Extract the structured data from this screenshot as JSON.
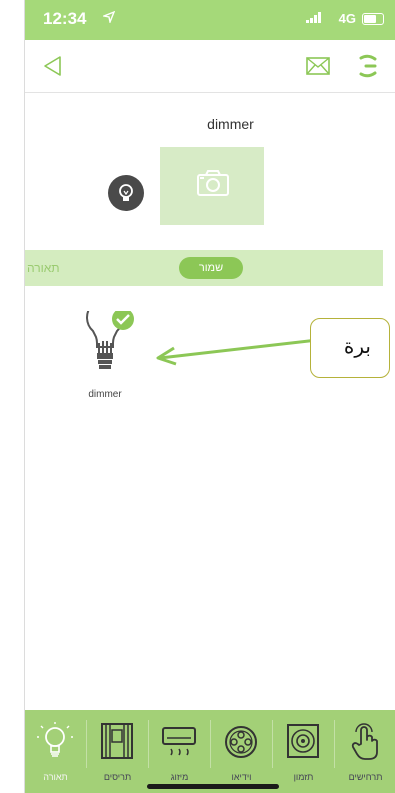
{
  "status_bar": {
    "time": "12:34",
    "network": "4G"
  },
  "nav": {
    "icons": [
      "back-icon",
      "mail-icon",
      "refresh-icon"
    ]
  },
  "device": {
    "name": "dimmer",
    "badge_icon": "lightbulb-icon",
    "photo_icon": "camera-icon"
  },
  "filter": {
    "category": "תאורה",
    "save_label": "שמור"
  },
  "devices": [
    {
      "label": "dimmer",
      "icon": "lightbulb-icon",
      "selected": true
    }
  ],
  "callout": {
    "text": "برة"
  },
  "bottom_nav": {
    "tabs": [
      {
        "label": "תאורה",
        "icon": "lightbulb-icon",
        "active": true
      },
      {
        "label": "תריסים",
        "icon": "window-blinds-icon",
        "active": false
      },
      {
        "label": "מיזוג",
        "icon": "air-conditioner-icon",
        "active": false
      },
      {
        "label": "וידיאו",
        "icon": "film-reel-icon",
        "active": false
      },
      {
        "label": "תזמון",
        "icon": "timer-icon",
        "active": false
      },
      {
        "label": "תרחישים",
        "icon": "touch-hand-icon",
        "active": false
      }
    ]
  },
  "colors": {
    "accent": "#8cc756",
    "status_bar": "#a5d979",
    "bottom_nav": "#a3d077",
    "filter_bar": "#d4ecbf"
  }
}
